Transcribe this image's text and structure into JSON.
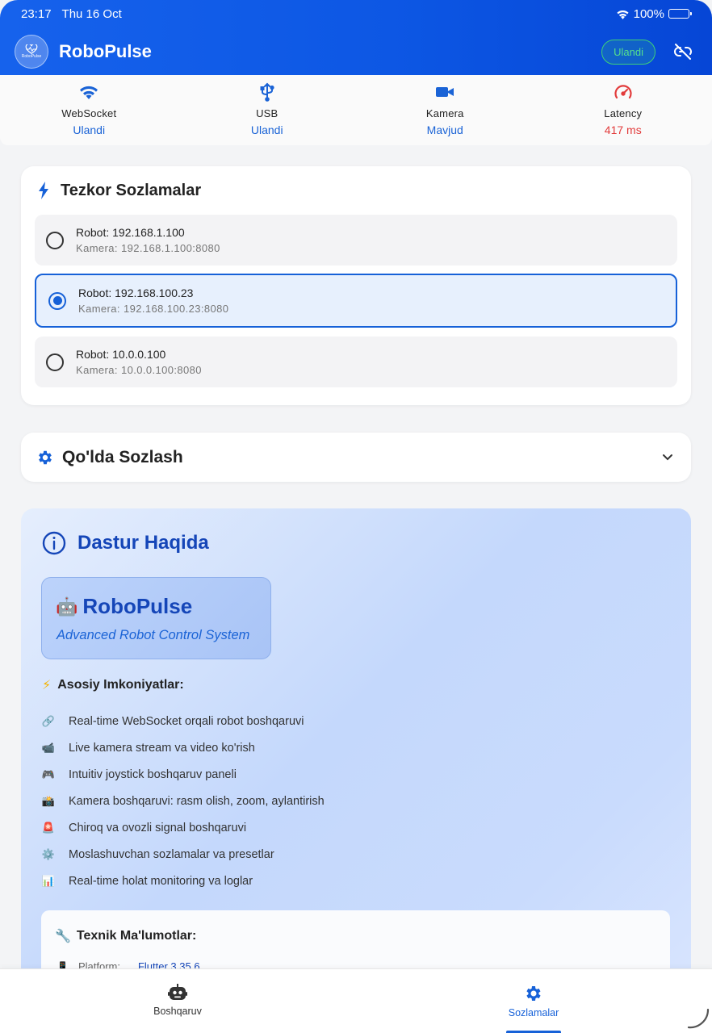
{
  "status_bar": {
    "time": "23:17",
    "date": "Thu 16 Oct",
    "battery": "100%"
  },
  "header": {
    "title": "RoboPulse",
    "logo_text": "RoboPulse",
    "connection_label": "Ulandi"
  },
  "status_strip": [
    {
      "label": "WebSocket",
      "value": "Ulandi",
      "icon": "wifi-icon"
    },
    {
      "label": "USB",
      "value": "Ulandi",
      "icon": "usb-icon"
    },
    {
      "label": "Kamera",
      "value": "Mavjud",
      "icon": "camera-icon"
    },
    {
      "label": "Latency",
      "value": "417 ms",
      "icon": "speedometer-icon"
    }
  ],
  "quick_settings": {
    "title": "Tezkor Sozlamalar",
    "presets": [
      {
        "robot": "Robot: 192.168.1.100",
        "camera": "Kamera: 192.168.1.100:8080",
        "selected": false
      },
      {
        "robot": "Robot: 192.168.100.23",
        "camera": "Kamera: 192.168.100.23:8080",
        "selected": true
      },
      {
        "robot": "Robot: 10.0.0.100",
        "camera": "Kamera: 10.0.0.100:8080",
        "selected": false
      }
    ]
  },
  "manual_settings": {
    "title": "Qo'lda Sozlash"
  },
  "about": {
    "title": "Dastur Haqida",
    "brand_name": "RoboPulse",
    "brand_emoji": "🤖",
    "tagline": "Advanced Robot Control System",
    "features_title": "Asosiy Imkoniyatlar:",
    "features_emoji": "⚡",
    "features": [
      {
        "emoji": "🔗",
        "text": "Real-time WebSocket orqali robot boshqaruvi"
      },
      {
        "emoji": "📹",
        "text": "Live kamera stream va video ko'rish"
      },
      {
        "emoji": "🎮",
        "text": "Intuitiv joystick boshqaruv paneli"
      },
      {
        "emoji": "📸",
        "text": "Kamera boshqaruvi: rasm olish, zoom, aylantirish"
      },
      {
        "emoji": "🚨",
        "text": "Chiroq va ovozli signal boshqaruvi"
      },
      {
        "emoji": "⚙️",
        "text": "Moslashuvchan sozlamalar va presetlar"
      },
      {
        "emoji": "📊",
        "text": "Real-time holat monitoring va loglar"
      }
    ],
    "tech": {
      "title": "Texnik Ma'lumotlar:",
      "title_emoji": "🔧",
      "rows": [
        {
          "emoji": "📱",
          "key": "Platform:",
          "value": "Flutter 3.35.6"
        }
      ]
    }
  },
  "bottom_nav": {
    "items": [
      {
        "label": "Boshqaruv",
        "icon": "robot-icon",
        "active": false
      },
      {
        "label": "Sozlamalar",
        "icon": "gear-icon",
        "active": true
      }
    ]
  },
  "colors": {
    "primary": "#1661d8",
    "header": "#0d57e4",
    "success": "#3dd07a",
    "danger": "#e23b3b"
  }
}
